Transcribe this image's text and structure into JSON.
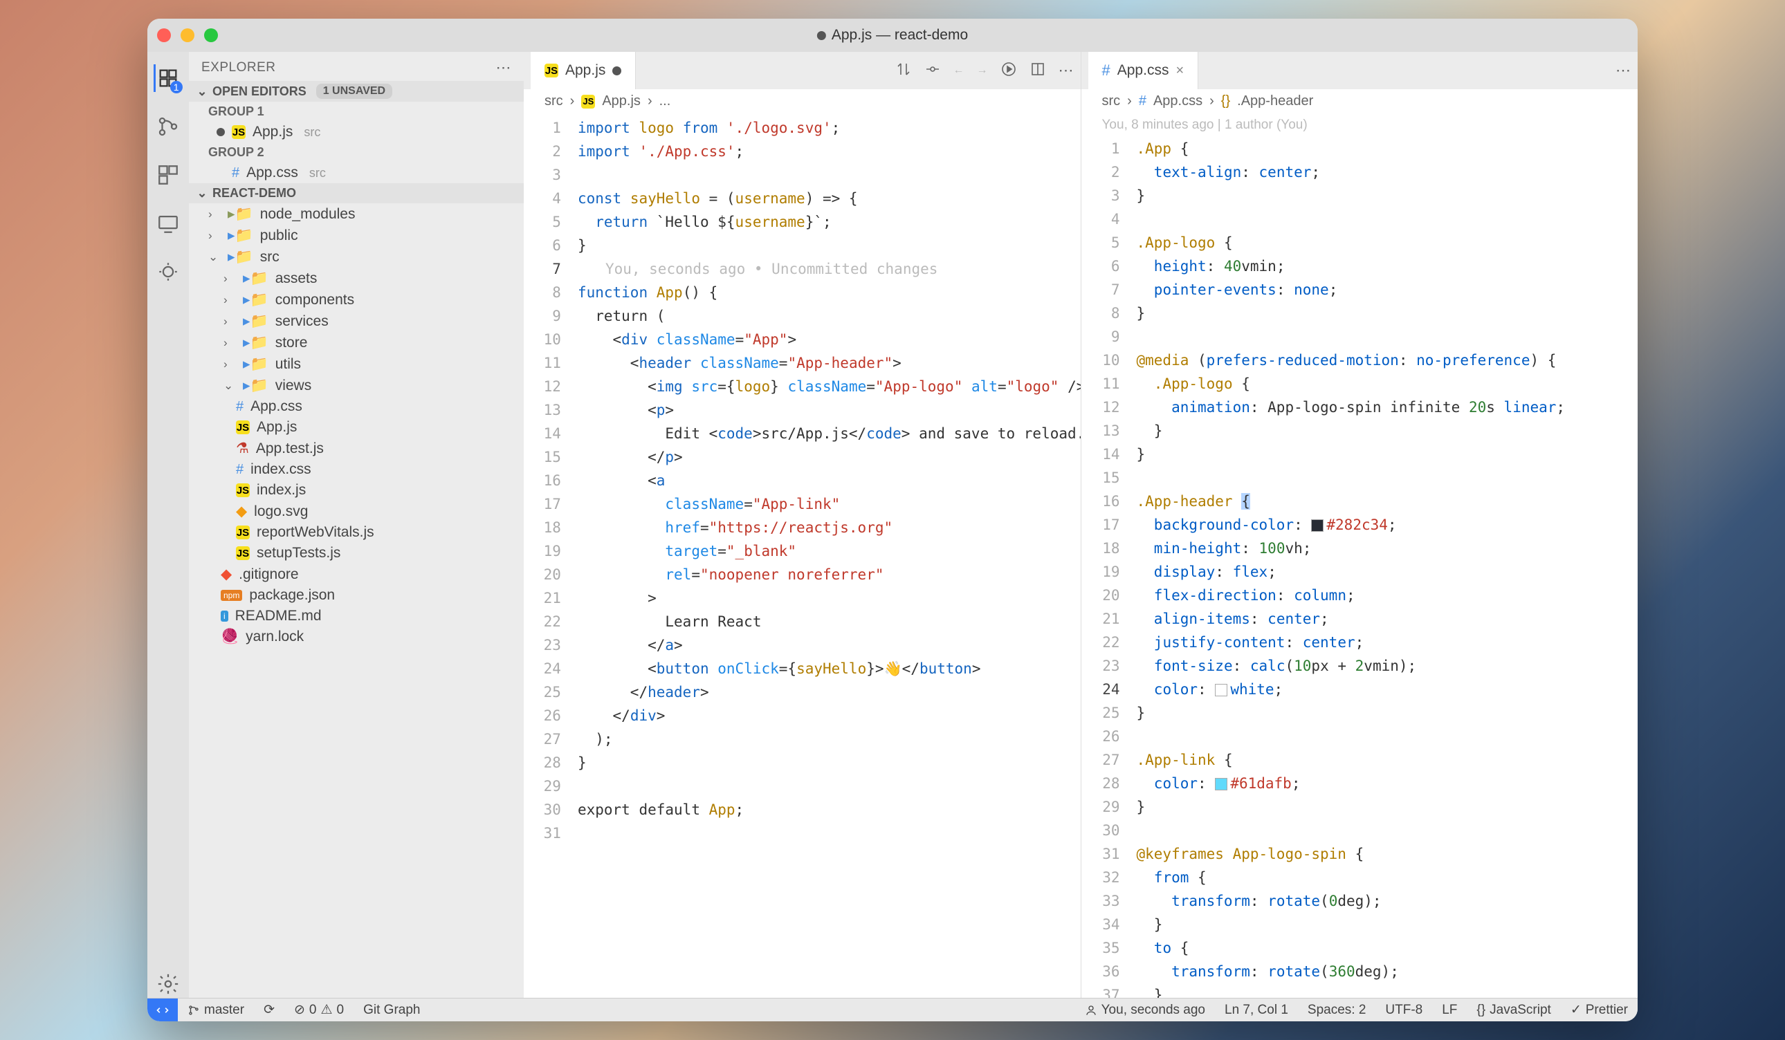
{
  "window": {
    "title": "App.js — react-demo",
    "modified": true
  },
  "activitybar": {
    "badge": "1",
    "items": [
      "explorer",
      "source-control",
      "extensions",
      "remote",
      "debug"
    ]
  },
  "sidebar": {
    "title": "EXPLORER",
    "openEditors": {
      "label": "OPEN EDITORS",
      "unsaved": "1 UNSAVED",
      "groups": [
        {
          "label": "GROUP 1",
          "items": [
            {
              "name": "App.js",
              "dir": "src",
              "modified": true,
              "icon": "js"
            }
          ]
        },
        {
          "label": "GROUP 2",
          "items": [
            {
              "name": "App.css",
              "dir": "src",
              "modified": false,
              "icon": "css"
            }
          ]
        }
      ]
    },
    "project": {
      "name": "REACT-DEMO",
      "tree": [
        {
          "name": "node_modules",
          "type": "folder",
          "expanded": false,
          "muted": true
        },
        {
          "name": "public",
          "type": "folder",
          "expanded": false
        },
        {
          "name": "src",
          "type": "folder",
          "expanded": true,
          "children": [
            {
              "name": "assets",
              "type": "folder"
            },
            {
              "name": "components",
              "type": "folder"
            },
            {
              "name": "services",
              "type": "folder"
            },
            {
              "name": "store",
              "type": "folder"
            },
            {
              "name": "utils",
              "type": "folder"
            },
            {
              "name": "views",
              "type": "folder",
              "expanded": true,
              "children": []
            },
            {
              "name": "App.css",
              "type": "file",
              "icon": "css"
            },
            {
              "name": "App.js",
              "type": "file",
              "icon": "js"
            },
            {
              "name": "App.test.js",
              "type": "file",
              "icon": "flask"
            },
            {
              "name": "index.css",
              "type": "file",
              "icon": "css"
            },
            {
              "name": "index.js",
              "type": "file",
              "icon": "js"
            },
            {
              "name": "logo.svg",
              "type": "file",
              "icon": "svg"
            },
            {
              "name": "reportWebVitals.js",
              "type": "file",
              "icon": "js"
            },
            {
              "name": "setupTests.js",
              "type": "file",
              "icon": "js"
            }
          ]
        },
        {
          "name": ".gitignore",
          "type": "file",
          "icon": "git"
        },
        {
          "name": "package.json",
          "type": "file",
          "icon": "json"
        },
        {
          "name": "README.md",
          "type": "file",
          "icon": "readme"
        },
        {
          "name": "yarn.lock",
          "type": "file",
          "icon": "yarn"
        }
      ]
    }
  },
  "editor_left": {
    "tab": {
      "name": "App.js",
      "icon": "js",
      "modified": true
    },
    "breadcrumb": [
      "src",
      "App.js",
      "..."
    ],
    "active_line": 7,
    "blame_inline": "You, seconds ago • Uncommitted changes",
    "code": {
      "1": {
        "t": "import",
        "parts": [
          "import ",
          "logo",
          " from ",
          "'./logo.svg'",
          ";"
        ]
      },
      "2": {
        "t": "import2",
        "parts": [
          "import ",
          "'./App.css'",
          ";"
        ]
      },
      "3": "",
      "4": {
        "parts": [
          "const ",
          "sayHello",
          " = (",
          "username",
          ") => {"
        ]
      },
      "5": {
        "parts": [
          "  return ",
          "`Hello ${",
          "username",
          "}`",
          ";"
        ]
      },
      "6": "}",
      "7": "",
      "8": {
        "parts": [
          "function ",
          "App",
          "() {"
        ]
      },
      "9": "  return (",
      "10": {
        "parts": [
          "    <",
          "div",
          " ",
          "className",
          "=",
          "\"App\"",
          ">"
        ]
      },
      "11": {
        "parts": [
          "      <",
          "header",
          " ",
          "className",
          "=",
          "\"App-header\"",
          ">"
        ]
      },
      "12": {
        "parts": [
          "        <",
          "img",
          " ",
          "src",
          "={",
          "logo",
          "} ",
          "className",
          "=",
          "\"App-logo\"",
          " ",
          "alt",
          "=",
          "\"logo\"",
          " />"
        ]
      },
      "13": {
        "parts": [
          "        <",
          "p",
          ">"
        ]
      },
      "14": {
        "parts": [
          "          Edit <",
          "code",
          ">src/App.js</",
          "code",
          "> and save to reload."
        ]
      },
      "15": {
        "parts": [
          "        </",
          "p",
          ">"
        ]
      },
      "16": {
        "parts": [
          "        <",
          "a"
        ]
      },
      "17": {
        "parts": [
          "          ",
          "className",
          "=",
          "\"App-link\""
        ]
      },
      "18": {
        "parts": [
          "          ",
          "href",
          "=",
          "\"https://reactjs.org\""
        ]
      },
      "19": {
        "parts": [
          "          ",
          "target",
          "=",
          "\"_blank\""
        ]
      },
      "20": {
        "parts": [
          "          ",
          "rel",
          "=",
          "\"noopener noreferrer\""
        ]
      },
      "21": "        >",
      "22": "          Learn React",
      "23": {
        "parts": [
          "        </",
          "a",
          ">"
        ]
      },
      "24": {
        "parts": [
          "        <",
          "button",
          " ",
          "onClick",
          "={",
          "sayHello",
          "}>👋</",
          "button",
          ">"
        ]
      },
      "25": {
        "parts": [
          "      </",
          "header",
          ">"
        ]
      },
      "26": {
        "parts": [
          "    </",
          "div",
          ">"
        ]
      },
      "27": "  );",
      "28": "}",
      "29": "",
      "30": {
        "parts": [
          "export default ",
          "App",
          ";"
        ]
      },
      "31": ""
    }
  },
  "editor_right": {
    "tab": {
      "name": "App.css",
      "icon": "css",
      "modified": false
    },
    "breadcrumb": [
      "src",
      "App.css",
      ".App-header"
    ],
    "blame_header": "You, 8 minutes ago | 1 author (You)",
    "active_line": 24,
    "code": {
      "1": {
        "parts": [
          ".App",
          " {"
        ]
      },
      "2": {
        "parts": [
          "  ",
          "text-align",
          ": ",
          "center",
          ";"
        ]
      },
      "3": "}",
      "4": "",
      "5": {
        "parts": [
          ".App-logo",
          " {"
        ]
      },
      "6": {
        "parts": [
          "  ",
          "height",
          ": ",
          "40",
          "vmin",
          ";"
        ]
      },
      "7": {
        "parts": [
          "  ",
          "pointer-events",
          ": ",
          "none",
          ";"
        ]
      },
      "8": "}",
      "9": "",
      "10": {
        "parts": [
          "@media",
          " (",
          "prefers-reduced-motion",
          ": ",
          "no-preference",
          ") {"
        ]
      },
      "11": {
        "parts": [
          "  ",
          ".App-logo",
          " {"
        ]
      },
      "12": {
        "parts": [
          "    ",
          "animation",
          ": ",
          "App-logo-spin ",
          "infinite ",
          "20",
          "s ",
          "linear",
          ";"
        ]
      },
      "13": "  }",
      "14": "}",
      "15": "",
      "16": {
        "parts": [
          ".App-header",
          " {"
        ]
      },
      "17": {
        "parts": [
          "  ",
          "background-color",
          ": ",
          "swatch:#282c34",
          "#282c34",
          ";"
        ]
      },
      "18": {
        "parts": [
          "  ",
          "min-height",
          ": ",
          "100",
          "vh",
          ";"
        ]
      },
      "19": {
        "parts": [
          "  ",
          "display",
          ": ",
          "flex",
          ";"
        ]
      },
      "20": {
        "parts": [
          "  ",
          "flex-direction",
          ": ",
          "column",
          ";"
        ]
      },
      "21": {
        "parts": [
          "  ",
          "align-items",
          ": ",
          "center",
          ";"
        ]
      },
      "22": {
        "parts": [
          "  ",
          "justify-content",
          ": ",
          "center",
          ";"
        ]
      },
      "23": {
        "parts": [
          "  ",
          "font-size",
          ": ",
          "calc",
          "(",
          "10",
          "px + ",
          "2",
          "vmin",
          ");"
        ]
      },
      "24": {
        "parts": [
          "  ",
          "color",
          ": ",
          "swatch:#ffffff",
          "white",
          ";"
        ]
      },
      "25": "}",
      "26": "",
      "27": {
        "parts": [
          ".App-link",
          " {"
        ]
      },
      "28": {
        "parts": [
          "  ",
          "color",
          ": ",
          "swatch:#61dafb",
          "#61dafb",
          ";"
        ]
      },
      "29": "}",
      "30": "",
      "31": {
        "parts": [
          "@keyframes",
          " ",
          "App-logo-spin",
          " {"
        ]
      },
      "32": {
        "parts": [
          "  ",
          "from",
          " {"
        ]
      },
      "33": {
        "parts": [
          "    ",
          "transform",
          ": ",
          "rotate",
          "(",
          "0",
          "deg",
          ");"
        ]
      },
      "34": "  }",
      "35": {
        "parts": [
          "  ",
          "to",
          " {"
        ]
      },
      "36": {
        "parts": [
          "    ",
          "transform",
          ": ",
          "rotate",
          "(",
          "360",
          "deg",
          ");"
        ]
      },
      "37": "  }"
    }
  },
  "statusbar": {
    "branch": "master",
    "sync": "⟳",
    "errors": "0",
    "warnings": "0",
    "gitgraph": "Git Graph",
    "blame": "You, seconds ago",
    "cursor": "Ln 7, Col 1",
    "spaces": "Spaces: 2",
    "encoding": "UTF-8",
    "eol": "LF",
    "lang": "JavaScript",
    "prettier": "Prettier"
  }
}
